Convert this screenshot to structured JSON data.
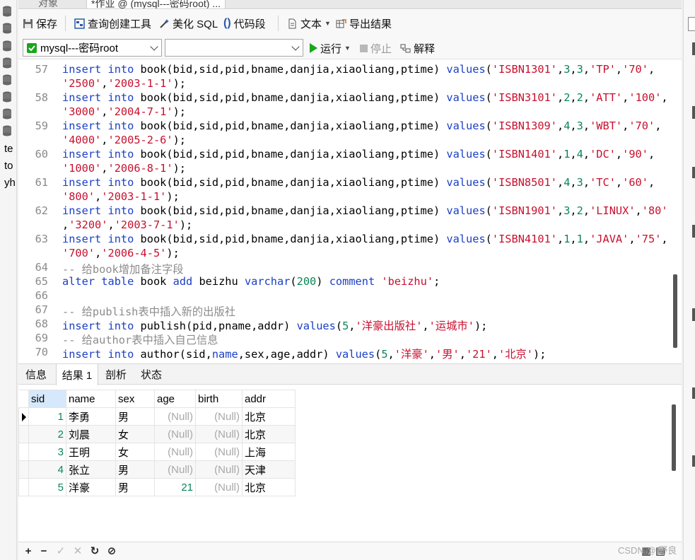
{
  "window": {
    "tabs": [
      {
        "label": "对象"
      },
      {
        "label": "*作业 @ (mysql---密码root) ..."
      }
    ]
  },
  "left_rail": {
    "partial_labels": [
      "te",
      "to",
      "yh"
    ]
  },
  "toolbar": {
    "save_label": "保存",
    "query_builder_label": "查询创建工具",
    "beautify_label": "美化 SQL",
    "snippet_label": "代码段",
    "text_label": "文本",
    "export_label": "导出结果"
  },
  "toolbar2": {
    "connection_value": "mysql---密码root",
    "database_value": "",
    "run_label": "运行",
    "stop_label": "停止",
    "explain_label": "解释"
  },
  "editor": {
    "line_numbers": [
      "57",
      "58",
      "59",
      "60",
      "61",
      "62",
      "63",
      "64",
      "65",
      "66",
      "67",
      "68",
      "69",
      "70"
    ]
  },
  "results": {
    "tabs": [
      "信息",
      "结果 1",
      "剖析",
      "状态"
    ],
    "active_tab": "结果 1",
    "columns": [
      "sid",
      "name",
      "sex",
      "age",
      "birth",
      "addr"
    ],
    "rows": [
      {
        "sid": "1",
        "name": "李勇",
        "sex": "男",
        "age": "(Null)",
        "birth": "(Null)",
        "addr": "北京"
      },
      {
        "sid": "2",
        "name": "刘晨",
        "sex": "女",
        "age": "(Null)",
        "birth": "(Null)",
        "addr": "北京"
      },
      {
        "sid": "3",
        "name": "王明",
        "sex": "女",
        "age": "(Null)",
        "birth": "(Null)",
        "addr": "上海"
      },
      {
        "sid": "4",
        "name": "张立",
        "sex": "男",
        "age": "(Null)",
        "birth": "(Null)",
        "addr": "天津"
      },
      {
        "sid": "5",
        "name": "洋豪",
        "sex": "男",
        "age": "21",
        "birth": "(Null)",
        "addr": "北京"
      }
    ]
  },
  "bottom_bar": {
    "watermark": "CSDN @ 野良"
  },
  "colors": {
    "keyword": "#1a3fc4",
    "string": "#c8102e",
    "number": "#098658",
    "comment": "#8c8c8c",
    "selected_header": "#d6e8fb",
    "run_green": "#1aa51a"
  }
}
